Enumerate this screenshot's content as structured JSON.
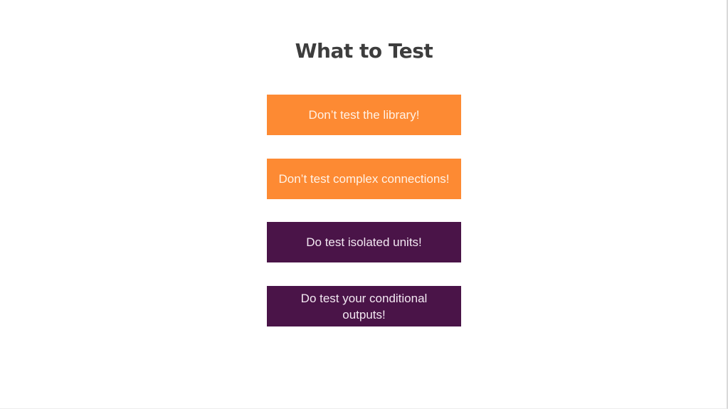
{
  "slide": {
    "title": "What to Test",
    "items": [
      {
        "text": "Don’t test the library!",
        "color": "#fd8a33"
      },
      {
        "text": "Don’t test complex connections!",
        "color": "#fd8a33"
      },
      {
        "text": "Do test isolated units!",
        "color": "#4a1448"
      },
      {
        "text": "Do test your conditional outputs!",
        "color": "#4a1448"
      }
    ]
  }
}
